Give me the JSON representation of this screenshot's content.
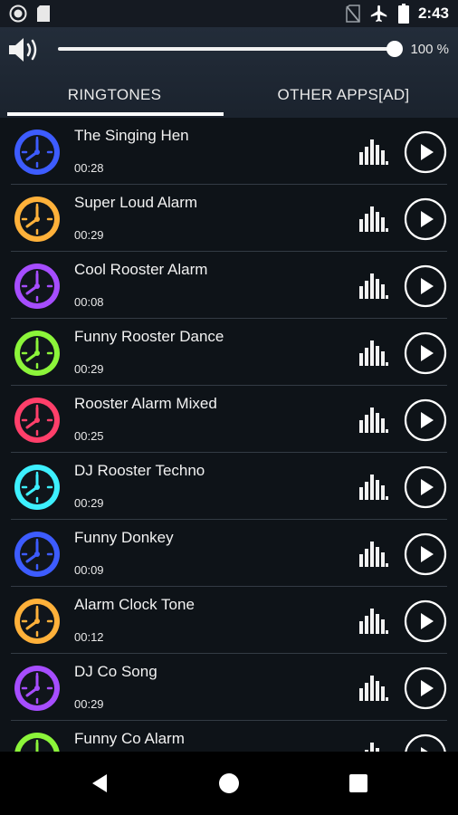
{
  "status_bar": {
    "time": "2:43"
  },
  "volume": {
    "level": 1.0,
    "percent_label": "100 %"
  },
  "tabs": [
    {
      "label": "RINGTONES",
      "active": true
    },
    {
      "label": "OTHER APPS[AD]",
      "active": false
    }
  ],
  "ringtones": [
    {
      "title": "The Singing Hen",
      "duration": "00:28",
      "color": "#3d5cff"
    },
    {
      "title": "Super Loud Alarm",
      "duration": "00:29",
      "color": "#ffb13a"
    },
    {
      "title": "Cool Rooster Alarm",
      "duration": "00:08",
      "color": "#a64dff"
    },
    {
      "title": "Funny Rooster Dance",
      "duration": "00:29",
      "color": "#8cf53a"
    },
    {
      "title": "Rooster Alarm Mixed",
      "duration": "00:25",
      "color": "#ff3f6a"
    },
    {
      "title": "DJ Rooster Techno",
      "duration": "00:29",
      "color": "#3df0ff"
    },
    {
      "title": "Funny Donkey",
      "duration": "00:09",
      "color": "#3d5cff"
    },
    {
      "title": "Alarm Clock Tone",
      "duration": "00:12",
      "color": "#ffb13a"
    },
    {
      "title": "DJ Co   Song",
      "duration": "00:29",
      "color": "#a64dff"
    },
    {
      "title": "Funny Co   Alarm",
      "duration": "",
      "color": "#8cf53a"
    }
  ]
}
